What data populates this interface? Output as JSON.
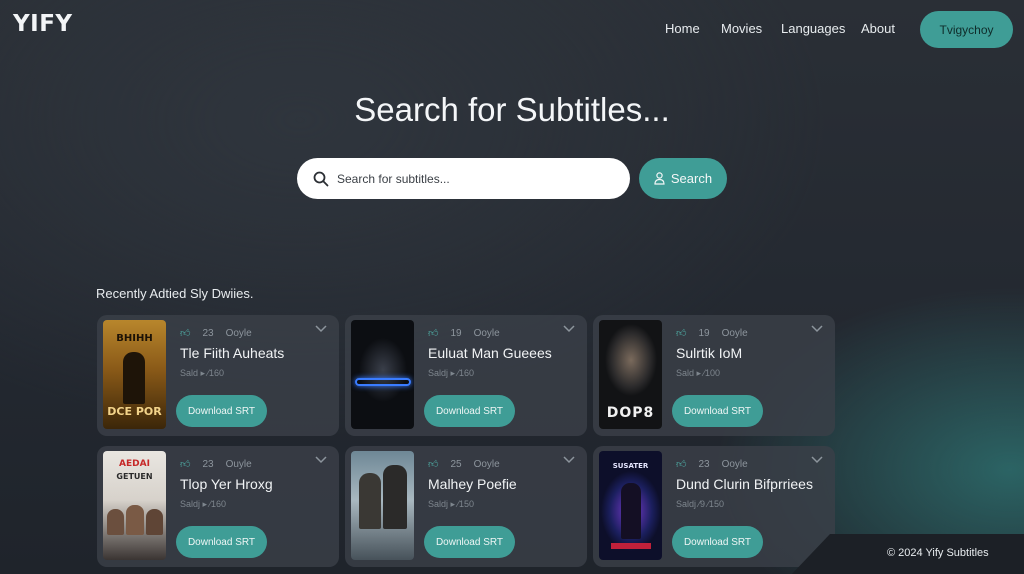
{
  "brand": {
    "logo": "YIFY"
  },
  "nav": {
    "items": [
      "Home",
      "Movies",
      "Languages",
      "About"
    ],
    "cta_label": "Tvigychoy"
  },
  "hero": {
    "title": "Search for Subtitles..."
  },
  "search": {
    "placeholder": "Search for subtitles...",
    "button_label": "Search"
  },
  "recent": {
    "title": "Recently Adtied Sly Dwiies.",
    "cards": [
      {
        "title": "Tle Fiith Auheats",
        "likes": "23",
        "tag": "Ooyle",
        "sub": "Sald ▸ ⁄160",
        "button": "Download SRT",
        "poster_text": [
          "BHIHH",
          "DCE POR"
        ]
      },
      {
        "title": "Euluat Man Gueees",
        "likes": "19",
        "tag": "Ooyle",
        "sub": "Saldj ▸ ⁄160",
        "button": "Download SRT",
        "poster_text": []
      },
      {
        "title": "Sulrtik IoM",
        "likes": "19",
        "tag": "Ooyle",
        "sub": "Sald ▸ ⁄100",
        "button": "Download SRT",
        "poster_text": [
          "DOP8"
        ]
      },
      {
        "title": "Tlop Yer Hroxg",
        "likes": "23",
        "tag": "Ouyle",
        "sub": "Saldj ▸ ⁄160",
        "button": "Download SRT",
        "poster_text": [
          "AEDAI",
          "GETUEN"
        ]
      },
      {
        "title": "Malhey Poefie",
        "likes": "25",
        "tag": "Ooyle",
        "sub": "Saldj ▸ ⁄150",
        "button": "Download SRT",
        "poster_text": []
      },
      {
        "title": "Dund Clurin Bifprriees",
        "likes": "23",
        "tag": "Ooyle",
        "sub": "Saldj ⁄9 ⁄150",
        "button": "Download SRT",
        "poster_text": [
          "SUSATER"
        ]
      }
    ]
  },
  "footer": {
    "text": "© 2024 Yify Subtitles"
  }
}
